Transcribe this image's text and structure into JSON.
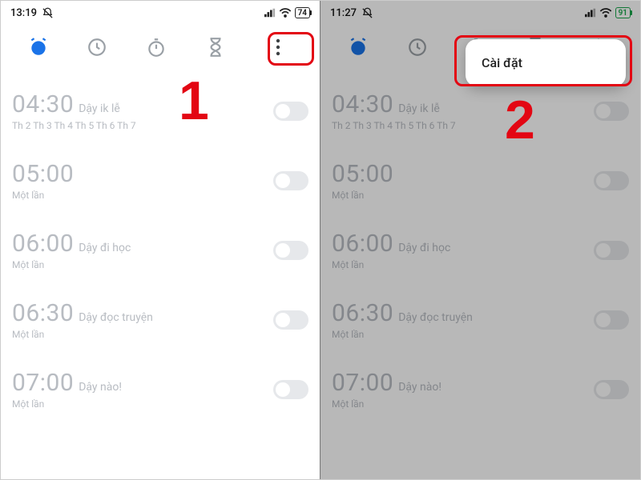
{
  "left": {
    "status": {
      "time": "13:19",
      "battery": "74"
    },
    "alarms": [
      {
        "time": "04:30",
        "label": "Dậy ik lễ",
        "sub": "Th 2 Th 3 Th 4 Th 5 Th 6 Th 7"
      },
      {
        "time": "05:00",
        "label": "",
        "sub": "Một lần"
      },
      {
        "time": "06:00",
        "label": "Dậy đi học",
        "sub": "Một lần"
      },
      {
        "time": "06:30",
        "label": "Dậy đọc truyện",
        "sub": "Một lần"
      },
      {
        "time": "07:00",
        "label": "Dậy nào!",
        "sub": "Một lần"
      }
    ],
    "step": "1"
  },
  "right": {
    "status": {
      "time": "11:27",
      "battery": "91"
    },
    "popup": {
      "settings": "Cài đặt"
    },
    "alarms": [
      {
        "time": "04:30",
        "label": "Dậy ik lễ",
        "sub": "Th 2 Th 3 Th 4 Th 5 Th 6 Th 7"
      },
      {
        "time": "05:00",
        "label": "",
        "sub": "Một lần"
      },
      {
        "time": "06:00",
        "label": "Dậy đi học",
        "sub": "Một lần"
      },
      {
        "time": "06:30",
        "label": "Dậy đọc truyện",
        "sub": "Một lần"
      },
      {
        "time": "07:00",
        "label": "Dậy nào!",
        "sub": "Một lần"
      }
    ],
    "step": "2"
  }
}
